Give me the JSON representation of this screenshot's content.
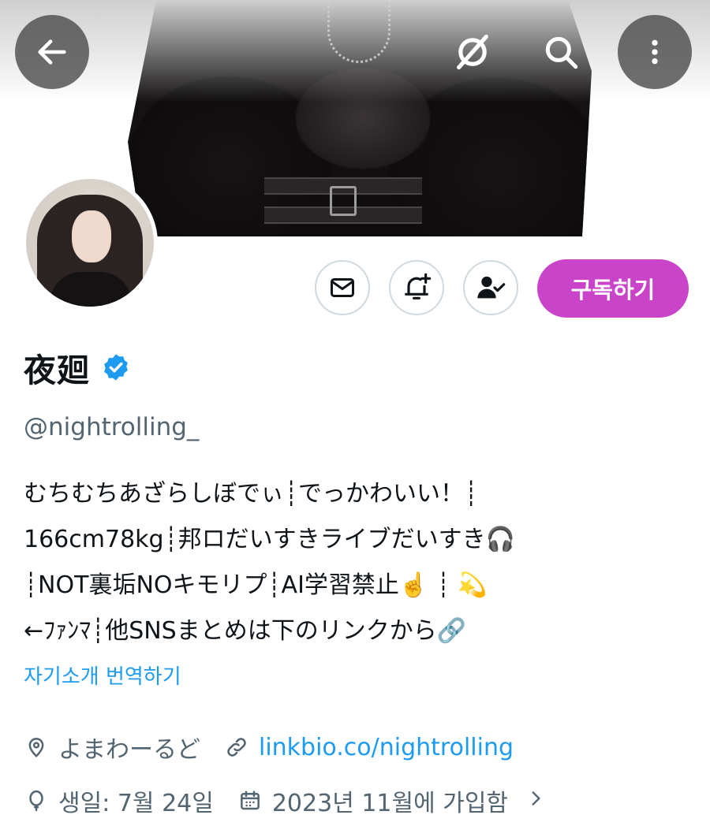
{
  "header": {
    "back_icon": "arrow-left-icon",
    "grok_icon": "grok-icon",
    "search_icon": "search-icon",
    "more_icon": "more-vertical-icon"
  },
  "actions": {
    "message_icon": "envelope-icon",
    "notify_icon": "bell-plus-icon",
    "follow_icon": "person-check-icon",
    "subscribe_label": "구독하기",
    "subscribe_color": "#c944c9"
  },
  "profile": {
    "display_name": "夜廻",
    "handle": "@nightrolling_",
    "bio": [
      "むちむちあざらしぼでぃ┊でっかわいい！┊",
      "166cm78kg┊邦ロだいすきライブだいすき🎧",
      "┊NOT裏垢NOキモリプ┊AI学習禁止☝️ ┊ 💫",
      "←ﾌｧﾝﾏ┊他SNSまとめは下のリンクから🔗"
    ],
    "translate_label": "자기소개 번역하기",
    "location": "よまわーるど",
    "website": "linkbio.co/nightrolling",
    "birthday": "생일: 7월 24일",
    "joined": "2023년 11월에 가입함"
  },
  "colors": {
    "accent": "#1d9bf0",
    "secondary_text": "#536471",
    "verified": "#1d9bf0"
  }
}
